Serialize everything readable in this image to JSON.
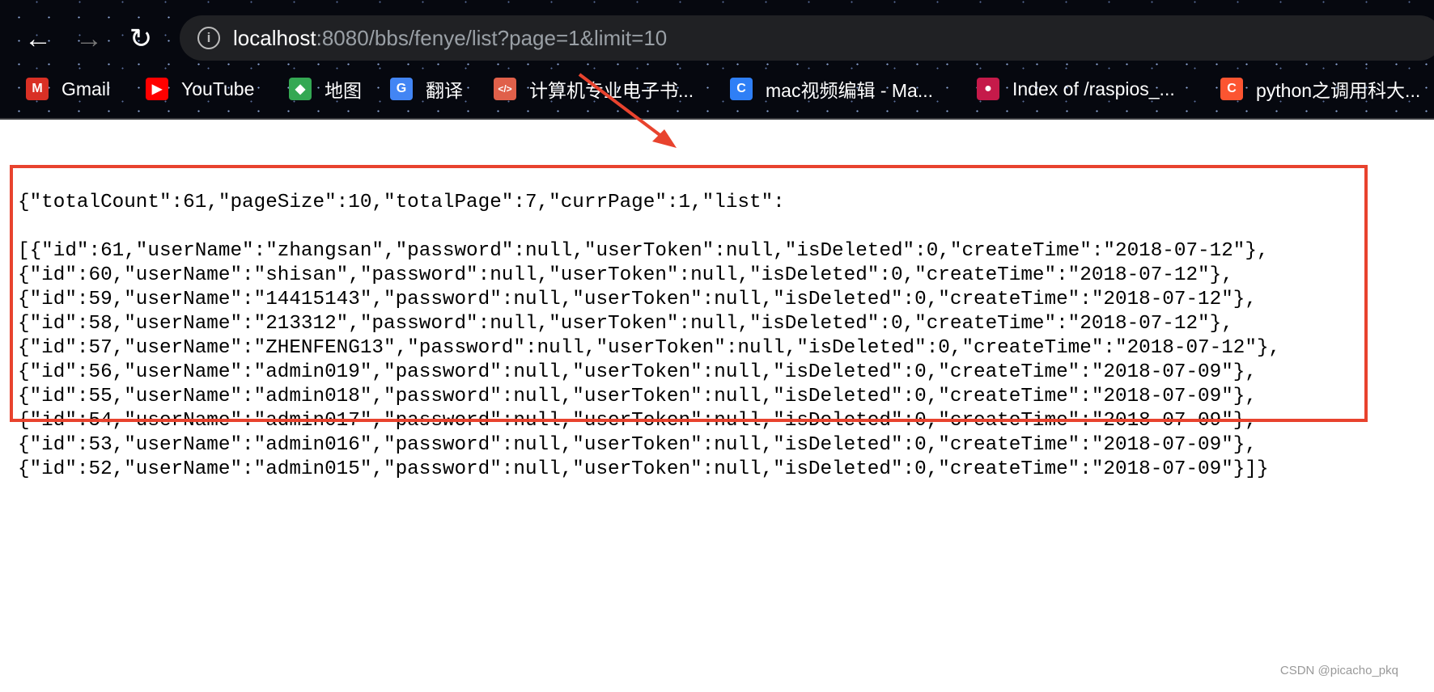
{
  "browser": {
    "url_host": "localhost",
    "url_rest": ":8080/bbs/fenye/list?page=1&limit=10",
    "bookmarks": [
      {
        "label": "Gmail",
        "icon": "gmail-icon",
        "color": "#d93025"
      },
      {
        "label": "YouTube",
        "icon": "youtube-icon",
        "color": "#ff0000"
      },
      {
        "label": "地图",
        "icon": "maps-icon",
        "color": "#34a853"
      },
      {
        "label": "翻译",
        "icon": "translate-icon",
        "color": "#4285f4"
      },
      {
        "label": "计算机专业电子书...",
        "icon": "code-icon",
        "color": "#e0604a"
      },
      {
        "label": "mac视频编辑 - Ma...",
        "icon": "c-logo-icon",
        "color": "#2f7ff6"
      },
      {
        "label": "Index of /raspios_...",
        "icon": "raspberry-icon",
        "color": "#c51a4a"
      },
      {
        "label": "python之调用科大...",
        "icon": "csdn-icon",
        "color": "#fc5531"
      }
    ]
  },
  "response": {
    "header_line": "{\"totalCount\":61,\"pageSize\":10,\"totalPage\":7,\"currPage\":1,\"list\":",
    "rows": [
      "[{\"id\":61,\"userName\":\"zhangsan\",\"password\":null,\"userToken\":null,\"isDeleted\":0,\"createTime\":\"2018-07-12\"},",
      "{\"id\":60,\"userName\":\"shisan\",\"password\":null,\"userToken\":null,\"isDeleted\":0,\"createTime\":\"2018-07-12\"},",
      "{\"id\":59,\"userName\":\"14415143\",\"password\":null,\"userToken\":null,\"isDeleted\":0,\"createTime\":\"2018-07-12\"},",
      "{\"id\":58,\"userName\":\"213312\",\"password\":null,\"userToken\":null,\"isDeleted\":0,\"createTime\":\"2018-07-12\"},",
      "{\"id\":57,\"userName\":\"ZHENFENG13\",\"password\":null,\"userToken\":null,\"isDeleted\":0,\"createTime\":\"2018-07-12\"},",
      "{\"id\":56,\"userName\":\"admin019\",\"password\":null,\"userToken\":null,\"isDeleted\":0,\"createTime\":\"2018-07-09\"},",
      "{\"id\":55,\"userName\":\"admin018\",\"password\":null,\"userToken\":null,\"isDeleted\":0,\"createTime\":\"2018-07-09\"},",
      "{\"id\":54,\"userName\":\"admin017\",\"password\":null,\"userToken\":null,\"isDeleted\":0,\"createTime\":\"2018-07-09\"},",
      "{\"id\":53,\"userName\":\"admin016\",\"password\":null,\"userToken\":null,\"isDeleted\":0,\"createTime\":\"2018-07-09\"},",
      "{\"id\":52,\"userName\":\"admin015\",\"password\":null,\"userToken\":null,\"isDeleted\":0,\"createTime\":\"2018-07-09\"}]}"
    ]
  },
  "annotation": {
    "color": "#e8432e"
  },
  "watermark": "CSDN @picacho_pkq"
}
